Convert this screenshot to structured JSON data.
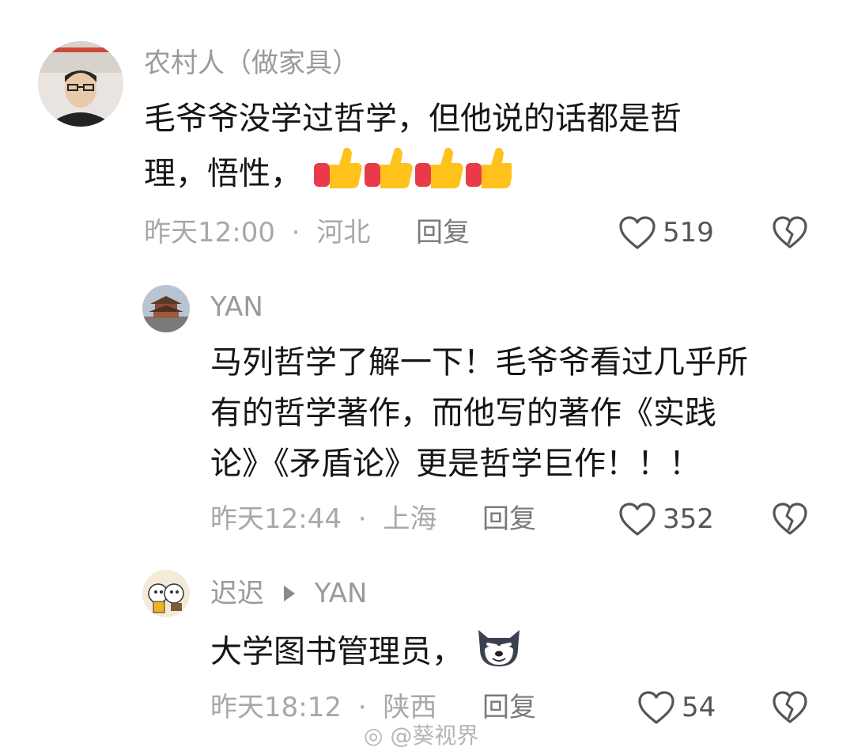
{
  "comments": [
    {
      "username": "农村人（做家具）",
      "text_line1": "毛爷爷没学过哲学，但他说的话都是哲",
      "text_line2": "理，悟性，",
      "time": "昨天12:00",
      "location": "河北",
      "reply_label": "回复",
      "likes": "519",
      "avatar_icon": "man-portrait-avatar",
      "emoji": "thumbs-up-icon"
    },
    {
      "username": "YAN",
      "text_line1": "马列哲学了解一下！毛爷爷看过几乎所",
      "text_line2": "有的哲学著作，而他写的著作《实践",
      "text_line3": "论》《矛盾论》更是哲学巨作！！！",
      "time": "昨天12:44",
      "location": "上海",
      "reply_label": "回复",
      "likes": "352",
      "avatar_icon": "temple-avatar"
    },
    {
      "username": "迟迟",
      "reply_to": "YAN",
      "text": "大学图书管理员，",
      "time": "昨天18:12",
      "location": "陕西",
      "reply_label": "回复",
      "likes": "54",
      "avatar_icon": "cartoon-avatar",
      "emoji": "husky-dog-emoji"
    }
  ],
  "separator": "·",
  "watermark": "@葵视界",
  "colors": {
    "username": "#9a9a9a",
    "meta": "#a8a8a8",
    "text": "#161616"
  }
}
